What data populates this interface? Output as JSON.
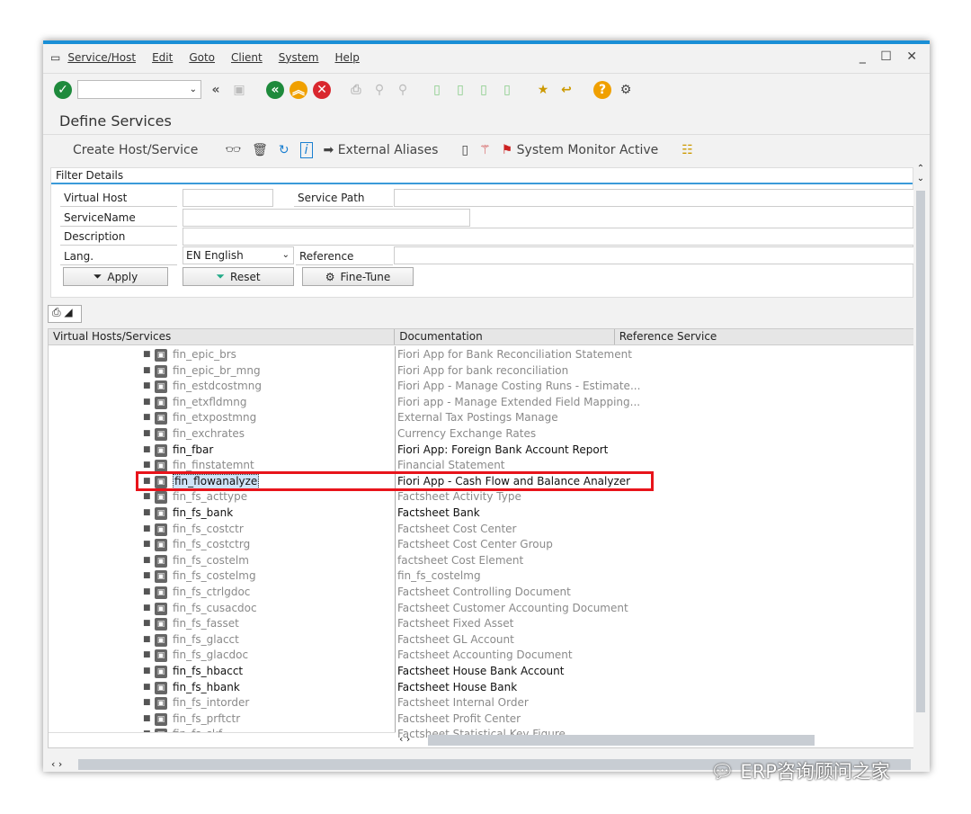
{
  "menu": {
    "items": [
      "Service/Host",
      "Edit",
      "Goto",
      "Client",
      "System",
      "Help"
    ]
  },
  "window_controls": "_ ☐ ✕",
  "screen_title": "Define Services",
  "app_toolbar": {
    "create": "Create Host/Service",
    "external_aliases": "External Aliases",
    "system_monitor": "System Monitor Active"
  },
  "filter": {
    "title": "Filter Details",
    "virtual_host_label": "Virtual Host",
    "virtual_host_value": "",
    "service_path_label": "Service Path",
    "service_path_value": "",
    "service_name_label": "ServiceName",
    "service_name_value": "",
    "description_label": "Description",
    "description_value": "",
    "lang_label": "Lang.",
    "lang_value": "EN English",
    "reference_label": "Reference",
    "reference_value": "",
    "apply": "Apply",
    "reset": "Reset",
    "fine_tune": "Fine-Tune"
  },
  "grid": {
    "columns": [
      "Virtual Hosts/Services",
      "Documentation",
      "Reference Service"
    ],
    "rows": [
      {
        "name": "fin_epic_brs",
        "doc": "Fiori App for Bank Reconciliation Statement",
        "active": false
      },
      {
        "name": "fin_epic_br_mng",
        "doc": "Fiori App for bank reconciliation",
        "active": false
      },
      {
        "name": "fin_estdcostmng",
        "doc": "Fiori App - Manage Costing Runs - Estimate...",
        "active": false
      },
      {
        "name": "fin_etxfldmng",
        "doc": "Fiori app - Manage Extended Field Mapping...",
        "active": false
      },
      {
        "name": "fin_etxpostmng",
        "doc": "External Tax Postings Manage",
        "active": false
      },
      {
        "name": "fin_exchrates",
        "doc": "Currency Exchange Rates",
        "active": false
      },
      {
        "name": "fin_fbar",
        "doc": "Fiori App: Foreign Bank Account Report",
        "active": true
      },
      {
        "name": "fin_finstatemnt",
        "doc": "Financial Statement",
        "active": false
      },
      {
        "name": "fin_flowanalyze",
        "doc": "Fiori App - Cash Flow and Balance Analyzer",
        "active": true,
        "selected": true
      },
      {
        "name": "fin_fs_acttype",
        "doc": "Factsheet Activity Type",
        "active": false
      },
      {
        "name": "fin_fs_bank",
        "doc": "Factsheet Bank",
        "active": true
      },
      {
        "name": "fin_fs_costctr",
        "doc": "Factsheet Cost  Center",
        "active": false
      },
      {
        "name": "fin_fs_costctrg",
        "doc": "Factsheet Cost Center Group",
        "active": false
      },
      {
        "name": "fin_fs_costelm",
        "doc": "factsheet Cost Element",
        "active": false
      },
      {
        "name": "fin_fs_costelmg",
        "doc": "fin_fs_costelmg",
        "active": false
      },
      {
        "name": "fin_fs_ctrlgdoc",
        "doc": "Factsheet Controlling Document",
        "active": false
      },
      {
        "name": "fin_fs_cusacdoc",
        "doc": "Factsheet Customer Accounting Document",
        "active": false
      },
      {
        "name": "fin_fs_fasset",
        "doc": "Factsheet Fixed Asset",
        "active": false
      },
      {
        "name": "fin_fs_glacct",
        "doc": "Factsheet GL Account",
        "active": false
      },
      {
        "name": "fin_fs_glacdoc",
        "doc": "Factsheet Accounting Document",
        "active": false
      },
      {
        "name": "fin_fs_hbacct",
        "doc": "Factsheet House Bank Account",
        "active": true
      },
      {
        "name": "fin_fs_hbank",
        "doc": "Factsheet House Bank",
        "active": true
      },
      {
        "name": "fin_fs_intorder",
        "doc": "Factsheet Internal Order",
        "active": false
      },
      {
        "name": "fin_fs_prftctr",
        "doc": "Factsheet Profit Center",
        "active": false
      },
      {
        "name": "fin_fs_skf",
        "doc": "Factsheet Statistical Key Figure",
        "active": false
      }
    ]
  },
  "highlight_color": "#e8141b",
  "watermark": "ERP咨询顾问之家"
}
